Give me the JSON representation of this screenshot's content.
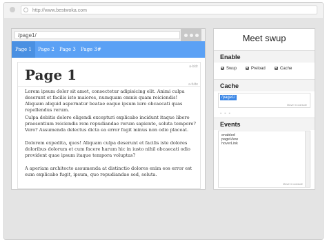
{
  "browser": {
    "url": "http://www.bestwoka.com"
  },
  "inner": {
    "url": "/page1/",
    "nav": [
      "Page 1",
      "Page 2",
      "Page 3",
      "Page 3#"
    ],
    "tag_top": "a-bldr",
    "tag_mid": "a-fulte",
    "heading": "Page 1",
    "paragraphs": [
      "Lorem ipsum dolor sit amet, consectetur adipisicing elit. Animi culpa deserunt et facilis iste maiores, numquam omnis quam reiciendis! Aliquam aliquid aspernatur beatae eaque ipsum iure obcaecati quas repellendus rerum.",
      "Culpa debitis dolore eligendi excepturi explicabo incidunt itaque libero praesentium reiciendis rem repudiandae rerum sapiente, soluta tempore? Vero? Assumenda delectus dicta ea error fugit minus non odio placeat.",
      "Dolorem expedita, quos! Aliquam culpa deserunt et facilis iste dolores doloribus dolorum et cum facere harum hic in iusto nihil obcaecati odio provident quae ipsum itaque tempora voluptas?",
      "A aperiam architecto assumenda at distinctio dolores enim eos error est eum explicabo fugit, ipsum, quo repudiandae sed, soluta."
    ],
    "paragraph_4_extra": "doloribus, dolorum et, non odio officia pariatur possimus quam, quaerat repellat."
  },
  "panel": {
    "title": "Meet swup",
    "enable_title": "Enable",
    "options": [
      "Swup",
      "Preload",
      "Cache"
    ],
    "cache_title": "Cache",
    "cache_value": "/page1/",
    "cache_hint": "Move in console",
    "dashes": "- - -",
    "events_title": "Events",
    "events": [
      "enabled",
      "pageView",
      "hoverLink"
    ],
    "events_hint": "Move in console"
  }
}
